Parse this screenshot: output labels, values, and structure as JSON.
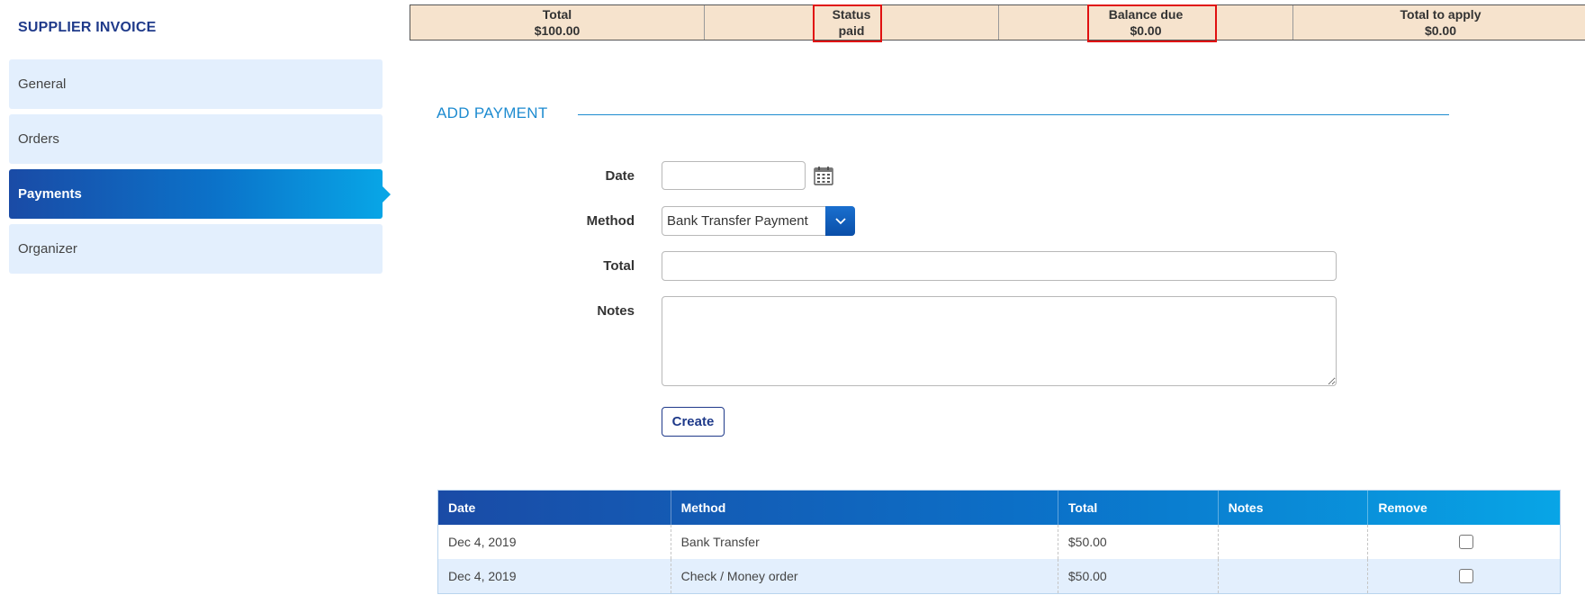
{
  "sidebar": {
    "title": "SUPPLIER INVOICE",
    "items": [
      {
        "label": "General"
      },
      {
        "label": "Orders"
      },
      {
        "label": "Payments"
      },
      {
        "label": "Organizer"
      }
    ]
  },
  "summary": {
    "total_label": "Total",
    "total_value": "$100.00",
    "status_label": "Status",
    "status_value": "paid",
    "balance_label": "Balance due",
    "balance_value": "$0.00",
    "apply_label": "Total to apply",
    "apply_value": "$0.00"
  },
  "add_payment": {
    "title": "ADD PAYMENT",
    "date_label": "Date",
    "date_value": "",
    "method_label": "Method",
    "method_value": "Bank Transfer Payment",
    "total_label": "Total",
    "total_value": "",
    "notes_label": "Notes",
    "notes_value": "",
    "create_label": "Create"
  },
  "payments_table": {
    "headers": [
      "Date",
      "Method",
      "Total",
      "Notes",
      "Remove"
    ],
    "rows": [
      {
        "date": "Dec 4, 2019",
        "method": "Bank Transfer",
        "total": "$50.00",
        "notes": ""
      },
      {
        "date": "Dec 4, 2019",
        "method": "Check / Money order",
        "total": "$50.00",
        "notes": ""
      }
    ]
  },
  "colors": {
    "brand_blue": "#1f3a8a",
    "accent": "#1d8bd0",
    "summary_bg": "#f6e3cd",
    "highlight": "#e01010"
  }
}
